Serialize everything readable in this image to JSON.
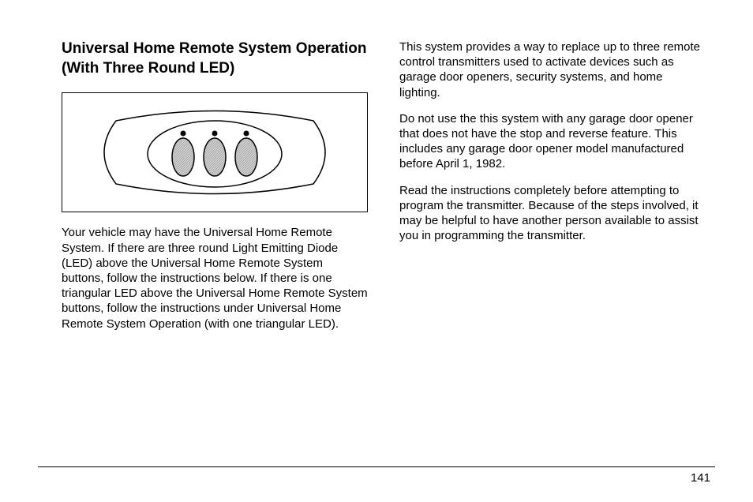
{
  "heading": "Universal Home Remote System Operation (With Three Round LED)",
  "left_paragraphs": [
    "Your vehicle may have the Universal Home Remote System. If there are three round Light Emitting Diode (LED) above the Universal Home Remote System buttons, follow the instructions below. If there is one triangular LED above the Universal Home Remote System buttons, follow the instructions under Universal Home Remote System Operation (with one triangular LED)."
  ],
  "right_paragraphs": [
    "This system provides a way to replace up to three remote control transmitters used to activate devices such as garage door openers, security systems, and home lighting.",
    "Do not use the this system with any garage door opener that does not have the stop and reverse feature. This includes any garage door opener model manufactured before April 1, 1982.",
    "Read the instructions completely before attempting to program the transmitter. Because of the steps involved, it may be helpful to have another person available to assist you in programming the transmitter."
  ],
  "page_number": "141"
}
